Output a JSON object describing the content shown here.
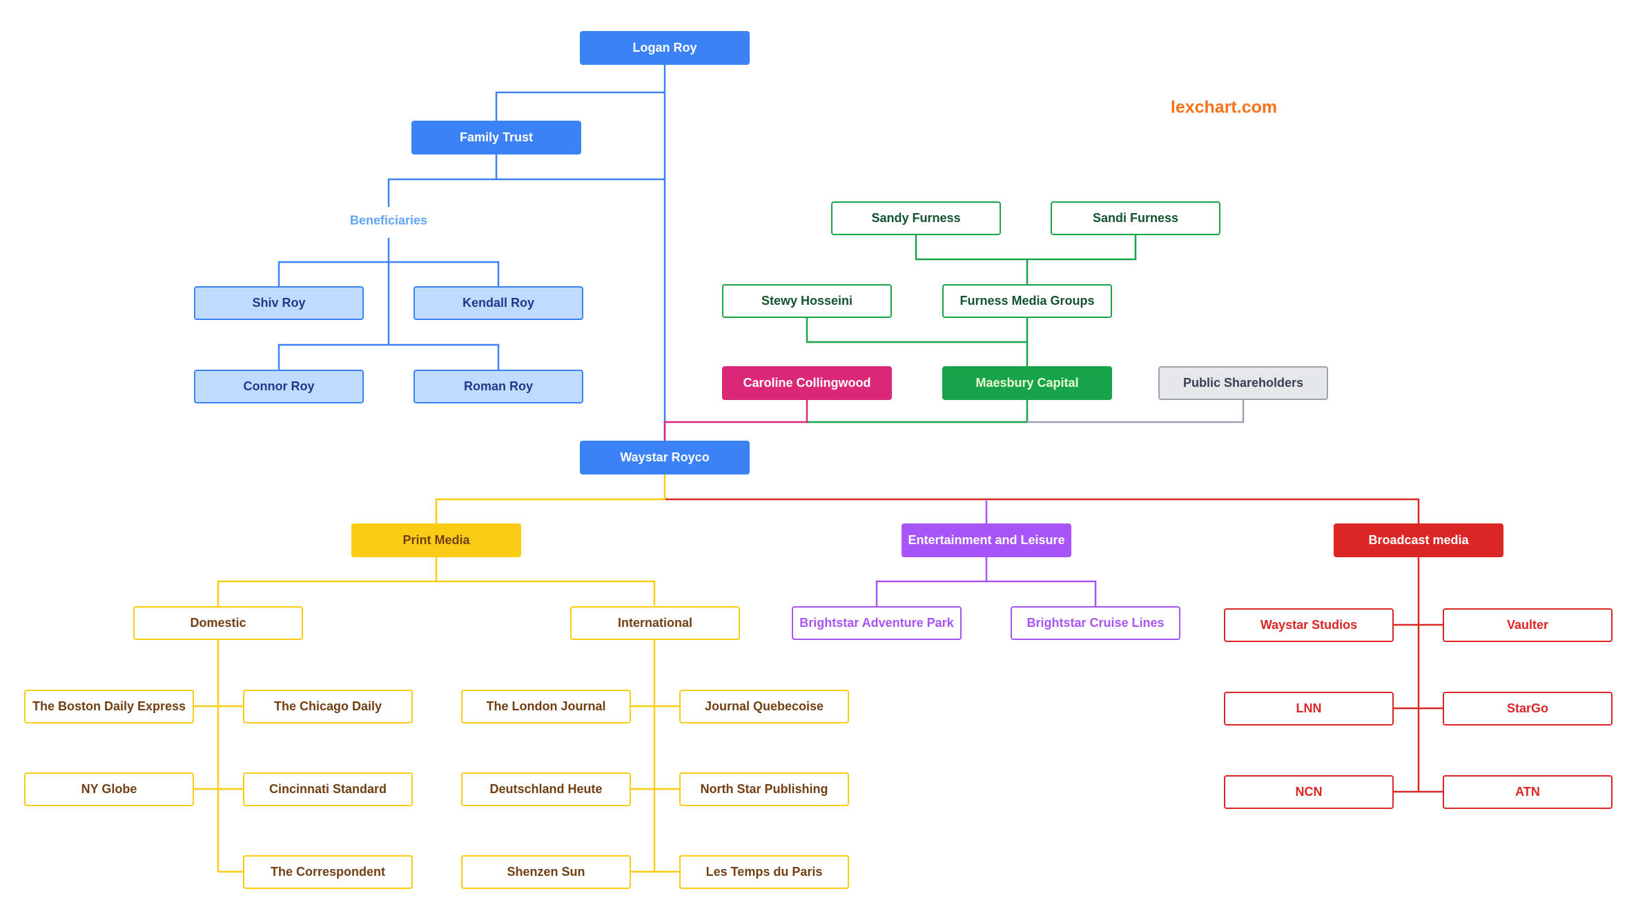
{
  "watermark": "lexchart.com",
  "colors": {
    "blue": "#3b82f6",
    "light_blue": "#bfdbfe",
    "green": "#16a34a",
    "pink": "#db2777",
    "gray": "#9ca3af",
    "yellow": "#facc15",
    "purple": "#a855f7",
    "red": "#dc2626",
    "brand_orange": "#f97316"
  },
  "family": {
    "root": "Logan Roy",
    "trust": "Family Trust",
    "beneficiaries_label": "Beneficiaries",
    "beneficiaries": [
      "Shiv Roy",
      "Kendall Roy",
      "Connor Roy",
      "Roman Roy"
    ]
  },
  "shareholders": {
    "furness_owners": [
      "Sandy Furness",
      "Sandi Furness"
    ],
    "stewy": "Stewy Hosseini",
    "furness_media": "Furness Media Groups",
    "caroline": "Caroline Collingwood",
    "maesbury": "Maesbury Capital",
    "public": "Public Shareholders"
  },
  "company": "Waystar Royco",
  "divisions": {
    "print": {
      "label": "Print Media",
      "domestic": {
        "label": "Domestic",
        "items": [
          "The Boston Daily Express",
          "The Chicago Daily",
          "NY Globe",
          "Cincinnati Standard",
          "The Correspondent"
        ]
      },
      "international": {
        "label": "International",
        "items": [
          "The London Journal",
          "Journal Quebecoise",
          "Deutschland Heute",
          "North Star Publishing",
          "Shenzen Sun",
          "Les Temps du Paris"
        ]
      }
    },
    "entertainment": {
      "label": "Entertainment and Leisure",
      "items": [
        "Brightstar Adventure Park",
        "Brightstar Cruise Lines"
      ]
    },
    "broadcast": {
      "label": "Broadcast media",
      "items": [
        "Waystar Studios",
        "Vaulter",
        "LNN",
        "StarGo",
        "NCN",
        "ATN"
      ]
    }
  }
}
